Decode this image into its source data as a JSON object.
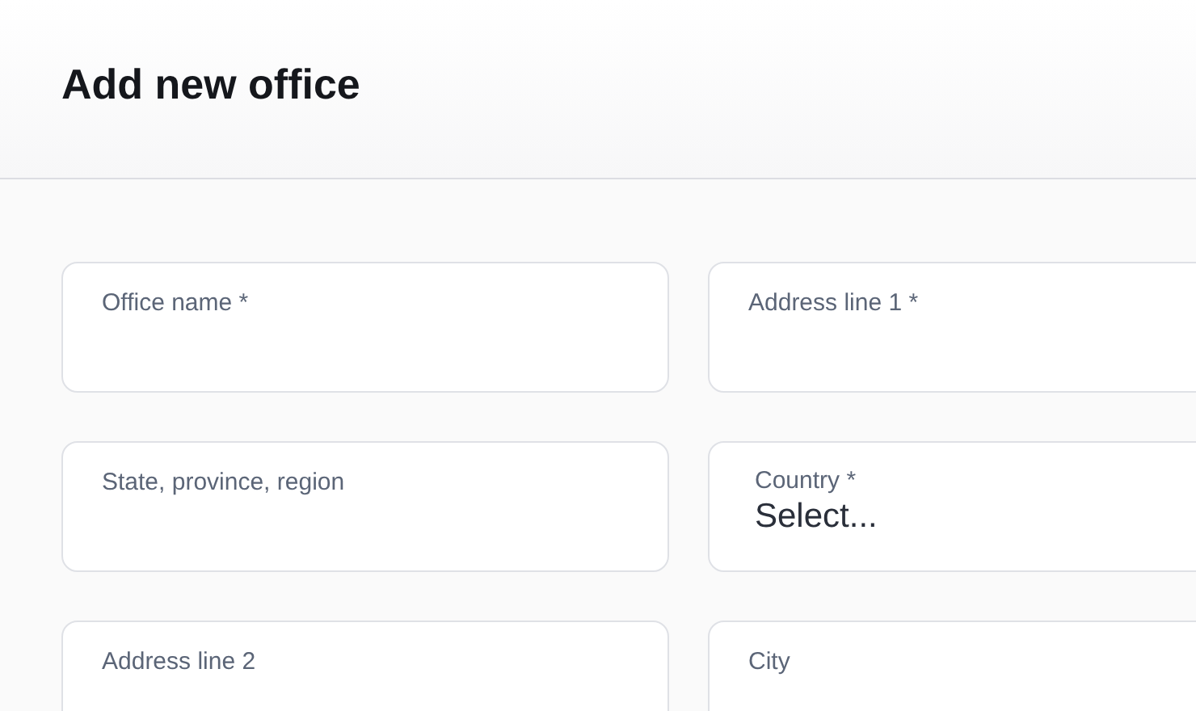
{
  "header": {
    "title": "Add new office"
  },
  "fields": [
    {
      "kind": "text",
      "label": "Office name *"
    },
    {
      "kind": "text",
      "label": "Address line 1 *"
    },
    {
      "kind": "text",
      "label": "State, province, region"
    },
    {
      "kind": "select",
      "label": "Country *",
      "placeholder": "Select..."
    },
    {
      "kind": "text",
      "label": "Address line 2"
    },
    {
      "kind": "text",
      "label": "City"
    }
  ]
}
